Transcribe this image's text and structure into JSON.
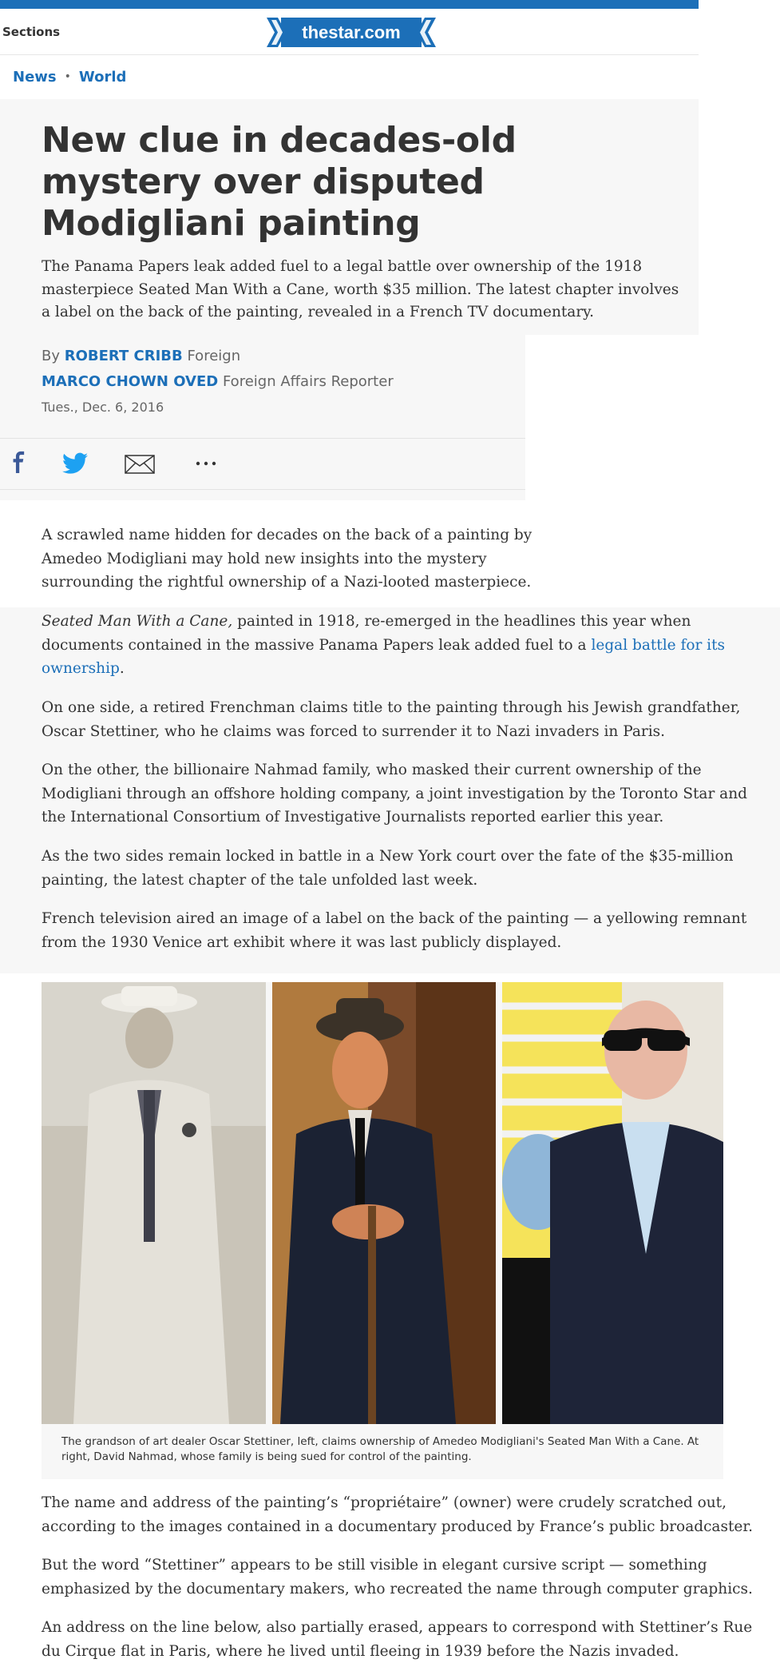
{
  "header": {
    "sections_label": "Sections",
    "logo_text": "thestar.com",
    "brand_color": "#1c6fb8"
  },
  "breadcrumb": {
    "items": [
      "News",
      "World"
    ]
  },
  "article": {
    "headline": "New clue in decades-old mystery over disputed Modigliani painting",
    "dek": "The Panama Papers leak added fuel to a legal battle over ownership of the 1918 masterpiece Seated Man With a Cane, worth $35 million. The latest chapter involves a label on the back of the painting, revealed in a French TV documentary.",
    "byline": {
      "by": "By",
      "author1": "ROBERT CRIBB",
      "author1_desk": "Foreign",
      "author2": "MARCO CHOWN OVED",
      "author2_desk": "Foreign Affairs Reporter",
      "date": "Tues., Dec. 6, 2016"
    },
    "share_icons": [
      "facebook-icon",
      "twitter-icon",
      "email-icon",
      "more-icon"
    ],
    "paragraphs": [
      "A scrawled name hidden for decades on the back of a painting by Amedeo Modigliani may hold new insights into the mystery surrounding the rightful ownership of a Nazi-looted masterpiece.",
      "On one side, a retired Frenchman claims title to the painting through his Jewish grandfather, Oscar Stettiner, who he claims was forced to surrender it to Nazi invaders in Paris.",
      "On the other, the billionaire Nahmad family, who masked their current ownership of the Modigliani through an offshore holding company, a joint investigation by the Toronto Star and the International Consortium of Investigative Journalists reported earlier this year.",
      "As the two sides remain locked in battle in a New York court over the fate of the $35-million painting, the latest chapter of the tale unfolded last week.",
      "French television aired an image of a label on the back of the painting — a yellowing remnant from the 1930 Venice art exhibit where it was last publicly displayed.",
      "The name and address of the painting’s “propriétaire” (owner) were crudely scratched out, according to the images contained in a documentary produced by France’s public broadcaster.",
      "But the word “Stettiner” appears to be still visible in elegant cursive script — something emphasized by the documentary makers, who recreated the name through computer graphics.",
      "An address on the line below, also partially erased, appears to correspond with Stettiner’s Rue du Cirque flat in Paris, where he lived until fleeing in 1939 before the Nazis invaded."
    ],
    "para2": {
      "italic": "Seated Man With a Cane,",
      "text": " painted in 1918, re-emerged in the headlines this year when documents contained in the massive Panama Papers leak added fuel to a ",
      "link": "legal battle for its ownership",
      "end": "."
    },
    "photo_caption": "The grandson of art dealer Oscar Stettiner, left, claims ownership of Amedeo Modigliani's Seated Man With a Cane. At right, David Nahmad, whose family is being sued for control of the painting."
  }
}
